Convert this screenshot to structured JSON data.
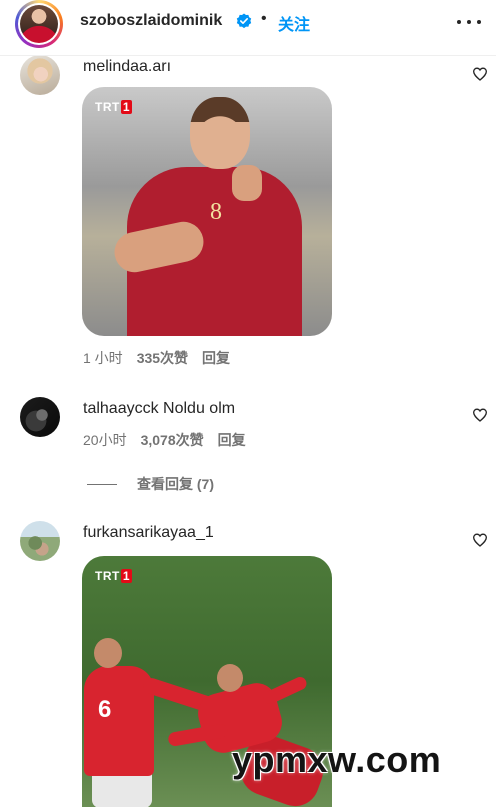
{
  "header": {
    "username": "szoboszlaidominik",
    "separator": "•",
    "follow_label": "关注",
    "verified_icon": "verified-badge-icon",
    "more_icon": "more-horizontal-icon"
  },
  "comments": [
    {
      "username": "melindaa.arı",
      "text": "",
      "media": {
        "type": "gif",
        "badge": "TRT",
        "badge_suffix": "1"
      },
      "time": "1 小时",
      "likes": "335次赞",
      "reply_label": "回复"
    },
    {
      "username": "talhaaycck",
      "text": "Noldu olm",
      "time": "20小时",
      "likes": "3,078次赞",
      "reply_label": "回复",
      "replies_toggle": "查看回复 (7)"
    },
    {
      "username": "furkansarikayaa_1",
      "text": "",
      "media": {
        "type": "gif",
        "badge": "TRT",
        "badge_suffix": "1"
      }
    }
  ],
  "watermark": "ypmxw.com",
  "colors": {
    "accent": "#0095f6",
    "text": "#262626",
    "muted": "#737373",
    "trt_red": "#e30a17"
  }
}
